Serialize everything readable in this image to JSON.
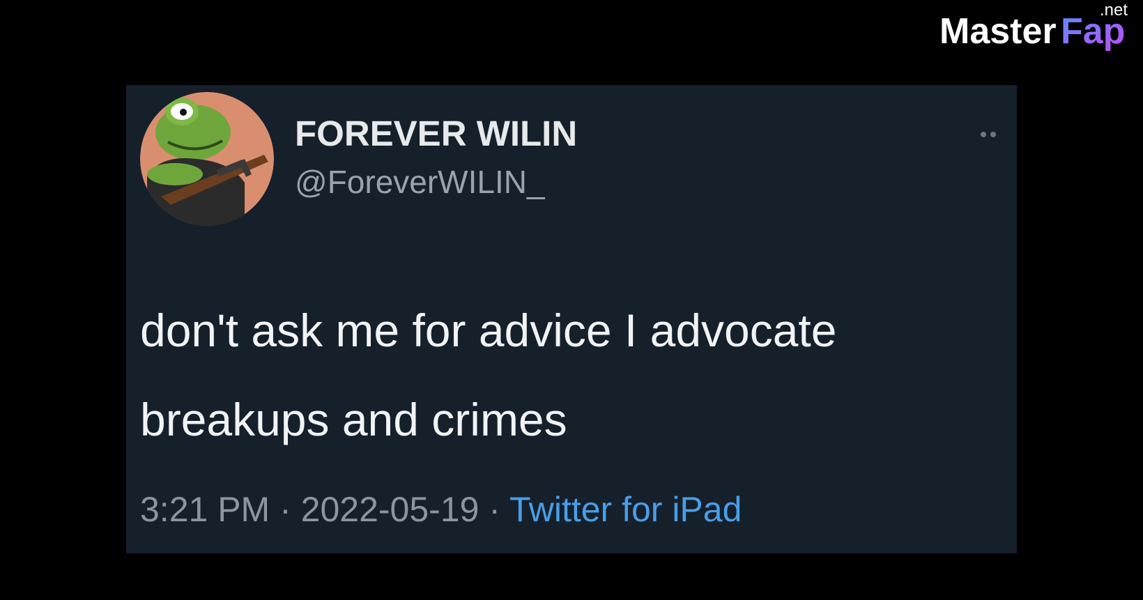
{
  "watermark": {
    "brand_main": "Master",
    "brand_accent": "Fap",
    "brand_tld": ".net"
  },
  "tweet": {
    "display_name": "FOREVER WILIN",
    "handle": "@ForeverWILIN_",
    "text": "don't ask me for advice I advocate\nbreakups and crimes",
    "time": "3:21 PM",
    "separator": " · ",
    "date": "2022-05-19",
    "source": "Twitter for iPad"
  },
  "icons": {
    "more": "more-options-icon",
    "avatar": "frog-avatar"
  },
  "colors": {
    "background": "#000000",
    "card": "#15202b",
    "source_link": "#4a9ee8",
    "watermark_accent": "#a64bf4"
  }
}
